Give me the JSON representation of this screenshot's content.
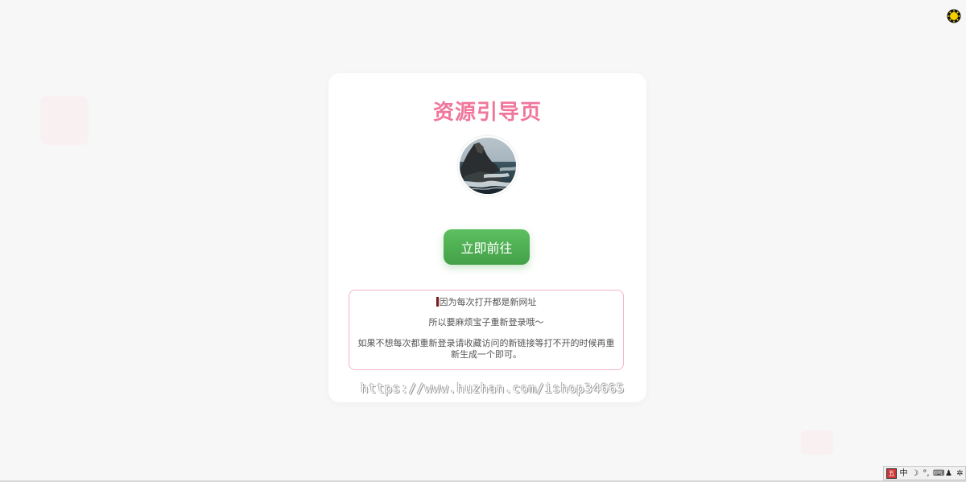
{
  "card": {
    "title": "资源引导页",
    "button_label": "立即前往",
    "notice": {
      "line1": "因为每次打开都是新网址",
      "line2": "所以要麻烦宝子重新登录哦～",
      "line3": "如果不想每次都重新登录请收藏访问的新链接等打不开的时候再重新生成一个即可。"
    }
  },
  "watermark": "https://www.huzhan.com/ishop34665",
  "ime": {
    "lang": "中",
    "icons": [
      "moon-icon",
      "punctuation-icon",
      "keyboard-icon",
      "user-icon",
      "settings-icon"
    ]
  },
  "colors": {
    "title": "#f0769b",
    "button": "#4caf50",
    "notice_border": "#f5b5c7",
    "background": "#f7f7f7"
  }
}
